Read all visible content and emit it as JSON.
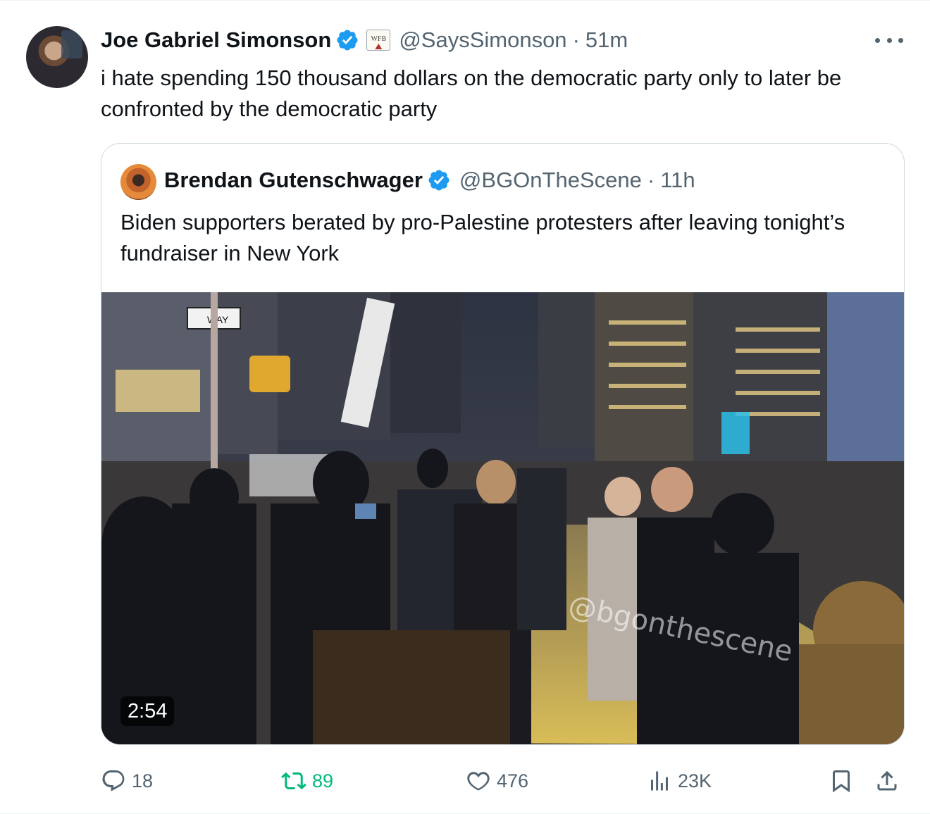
{
  "tweet": {
    "author_name": "Joe Gabriel Simonson",
    "affiliation_badge_text": "WFB",
    "handle": "@SaysSimonson",
    "separator": "·",
    "time": "51m",
    "text": "i hate spending 150 thousand dollars on the democratic party only to later be confronted by the democratic party"
  },
  "quoted": {
    "author_name": "Brendan Gutenschwager",
    "handle": "@BGOnTheScene",
    "separator": "·",
    "time": "11h",
    "text": "Biden supporters berated by pro-Palestine protesters after leaving tonight’s fundraiser in New York",
    "video": {
      "duration": "2:54",
      "watermark": "@bgonthescene",
      "sign_text": "WAY"
    }
  },
  "actions": {
    "replies": "18",
    "reposts": "89",
    "likes": "476",
    "views": "23K"
  },
  "colors": {
    "verified": "#1d9bf0",
    "repost_active": "#00ba7c",
    "secondary_text": "#536471",
    "border": "#cfd9de"
  },
  "icons": [
    "verified-badge-icon",
    "affiliation-badge-icon",
    "more-icon",
    "reply-icon",
    "repost-icon",
    "like-icon",
    "views-icon",
    "bookmark-icon",
    "share-icon"
  ]
}
